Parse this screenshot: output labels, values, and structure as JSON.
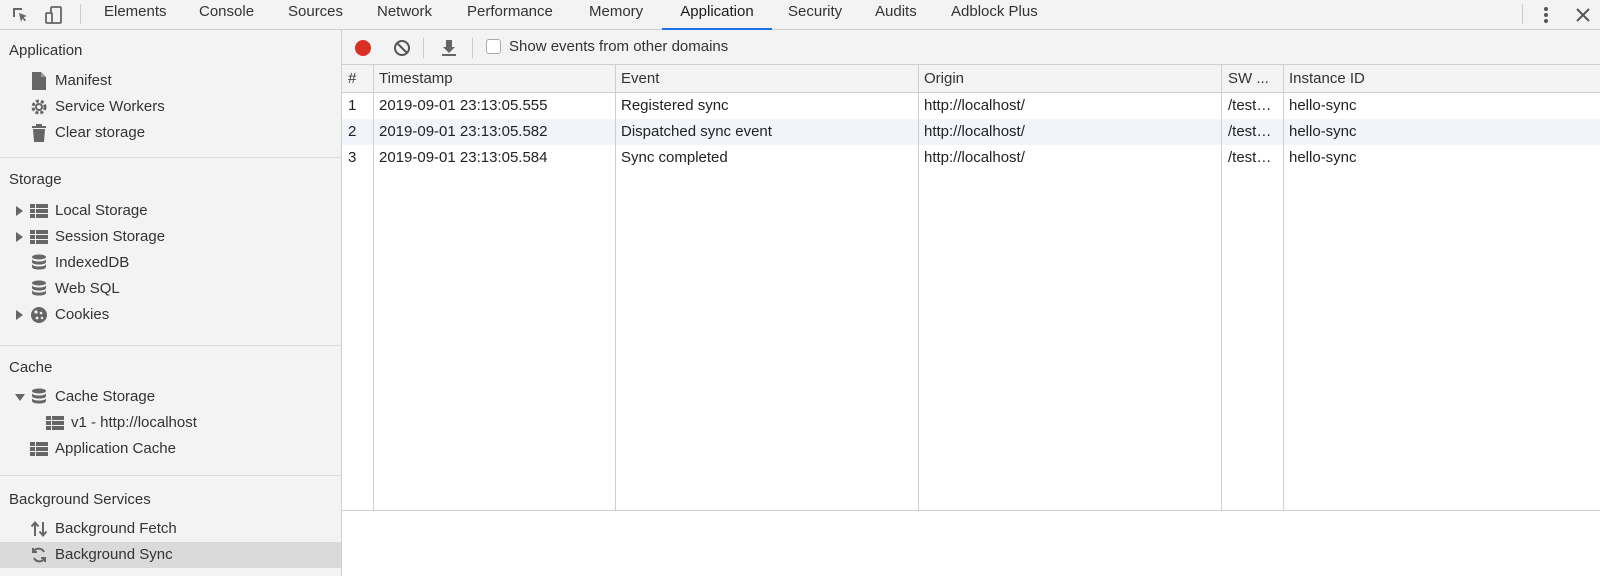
{
  "tabs": {
    "items": [
      "Elements",
      "Console",
      "Sources",
      "Network",
      "Performance",
      "Memory",
      "Application",
      "Security",
      "Audits",
      "Adblock Plus"
    ],
    "active": "Application"
  },
  "sidebar": {
    "application": {
      "title": "Application",
      "items": [
        "Manifest",
        "Service Workers",
        "Clear storage"
      ]
    },
    "storage": {
      "title": "Storage",
      "items": [
        "Local Storage",
        "Session Storage",
        "IndexedDB",
        "Web SQL",
        "Cookies"
      ]
    },
    "cache": {
      "title": "Cache",
      "items": [
        "Cache Storage",
        "v1 - http://localhost",
        "Application Cache"
      ]
    },
    "background": {
      "title": "Background Services",
      "items": [
        "Background Fetch",
        "Background Sync"
      ],
      "selected": "Background Sync"
    }
  },
  "toolbar": {
    "show_other_domains_label": "Show events from other domains",
    "show_other_domains_checked": false
  },
  "table": {
    "columns": [
      "#",
      "Timestamp",
      "Event",
      "Origin",
      "SW ...",
      "Instance ID"
    ],
    "rows": [
      [
        "1",
        "2019-09-01 23:13:05.555",
        "Registered sync",
        "http://localhost/",
        "/test…",
        "hello-sync"
      ],
      [
        "2",
        "2019-09-01 23:13:05.582",
        "Dispatched sync event",
        "http://localhost/",
        "/test…",
        "hello-sync"
      ],
      [
        "3",
        "2019-09-01 23:13:05.584",
        "Sync completed",
        "http://localhost/",
        "/test…",
        "hello-sync"
      ]
    ]
  },
  "colors": {
    "record": "#d93025",
    "accent": "#1a73e8",
    "selected_row": "#dadada",
    "alt_row": "#f1f5fb"
  }
}
